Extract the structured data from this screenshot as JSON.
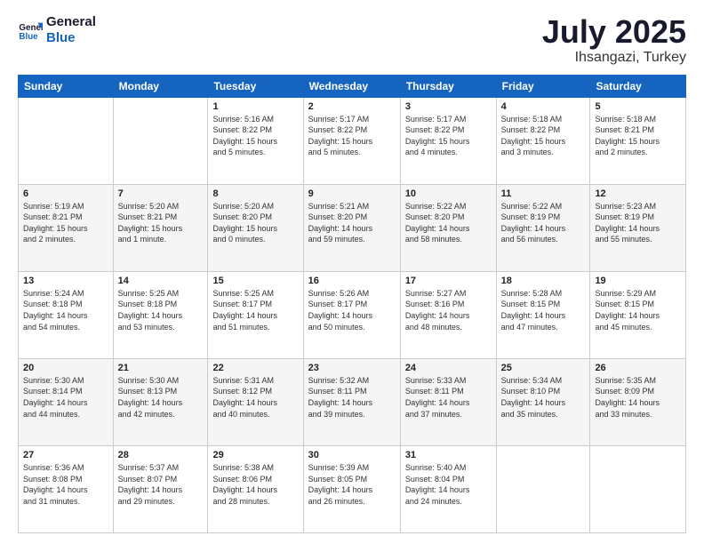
{
  "logo": {
    "text_general": "General",
    "text_blue": "Blue"
  },
  "header": {
    "month": "July 2025",
    "location": "Ihsangazi, Turkey"
  },
  "weekdays": [
    "Sunday",
    "Monday",
    "Tuesday",
    "Wednesday",
    "Thursday",
    "Friday",
    "Saturday"
  ],
  "weeks": [
    [
      {
        "day": "",
        "info": ""
      },
      {
        "day": "",
        "info": ""
      },
      {
        "day": "1",
        "info": "Sunrise: 5:16 AM\nSunset: 8:22 PM\nDaylight: 15 hours\nand 5 minutes."
      },
      {
        "day": "2",
        "info": "Sunrise: 5:17 AM\nSunset: 8:22 PM\nDaylight: 15 hours\nand 5 minutes."
      },
      {
        "day": "3",
        "info": "Sunrise: 5:17 AM\nSunset: 8:22 PM\nDaylight: 15 hours\nand 4 minutes."
      },
      {
        "day": "4",
        "info": "Sunrise: 5:18 AM\nSunset: 8:22 PM\nDaylight: 15 hours\nand 3 minutes."
      },
      {
        "day": "5",
        "info": "Sunrise: 5:18 AM\nSunset: 8:21 PM\nDaylight: 15 hours\nand 2 minutes."
      }
    ],
    [
      {
        "day": "6",
        "info": "Sunrise: 5:19 AM\nSunset: 8:21 PM\nDaylight: 15 hours\nand 2 minutes."
      },
      {
        "day": "7",
        "info": "Sunrise: 5:20 AM\nSunset: 8:21 PM\nDaylight: 15 hours\nand 1 minute."
      },
      {
        "day": "8",
        "info": "Sunrise: 5:20 AM\nSunset: 8:20 PM\nDaylight: 15 hours\nand 0 minutes."
      },
      {
        "day": "9",
        "info": "Sunrise: 5:21 AM\nSunset: 8:20 PM\nDaylight: 14 hours\nand 59 minutes."
      },
      {
        "day": "10",
        "info": "Sunrise: 5:22 AM\nSunset: 8:20 PM\nDaylight: 14 hours\nand 58 minutes."
      },
      {
        "day": "11",
        "info": "Sunrise: 5:22 AM\nSunset: 8:19 PM\nDaylight: 14 hours\nand 56 minutes."
      },
      {
        "day": "12",
        "info": "Sunrise: 5:23 AM\nSunset: 8:19 PM\nDaylight: 14 hours\nand 55 minutes."
      }
    ],
    [
      {
        "day": "13",
        "info": "Sunrise: 5:24 AM\nSunset: 8:18 PM\nDaylight: 14 hours\nand 54 minutes."
      },
      {
        "day": "14",
        "info": "Sunrise: 5:25 AM\nSunset: 8:18 PM\nDaylight: 14 hours\nand 53 minutes."
      },
      {
        "day": "15",
        "info": "Sunrise: 5:25 AM\nSunset: 8:17 PM\nDaylight: 14 hours\nand 51 minutes."
      },
      {
        "day": "16",
        "info": "Sunrise: 5:26 AM\nSunset: 8:17 PM\nDaylight: 14 hours\nand 50 minutes."
      },
      {
        "day": "17",
        "info": "Sunrise: 5:27 AM\nSunset: 8:16 PM\nDaylight: 14 hours\nand 48 minutes."
      },
      {
        "day": "18",
        "info": "Sunrise: 5:28 AM\nSunset: 8:15 PM\nDaylight: 14 hours\nand 47 minutes."
      },
      {
        "day": "19",
        "info": "Sunrise: 5:29 AM\nSunset: 8:15 PM\nDaylight: 14 hours\nand 45 minutes."
      }
    ],
    [
      {
        "day": "20",
        "info": "Sunrise: 5:30 AM\nSunset: 8:14 PM\nDaylight: 14 hours\nand 44 minutes."
      },
      {
        "day": "21",
        "info": "Sunrise: 5:30 AM\nSunset: 8:13 PM\nDaylight: 14 hours\nand 42 minutes."
      },
      {
        "day": "22",
        "info": "Sunrise: 5:31 AM\nSunset: 8:12 PM\nDaylight: 14 hours\nand 40 minutes."
      },
      {
        "day": "23",
        "info": "Sunrise: 5:32 AM\nSunset: 8:11 PM\nDaylight: 14 hours\nand 39 minutes."
      },
      {
        "day": "24",
        "info": "Sunrise: 5:33 AM\nSunset: 8:11 PM\nDaylight: 14 hours\nand 37 minutes."
      },
      {
        "day": "25",
        "info": "Sunrise: 5:34 AM\nSunset: 8:10 PM\nDaylight: 14 hours\nand 35 minutes."
      },
      {
        "day": "26",
        "info": "Sunrise: 5:35 AM\nSunset: 8:09 PM\nDaylight: 14 hours\nand 33 minutes."
      }
    ],
    [
      {
        "day": "27",
        "info": "Sunrise: 5:36 AM\nSunset: 8:08 PM\nDaylight: 14 hours\nand 31 minutes."
      },
      {
        "day": "28",
        "info": "Sunrise: 5:37 AM\nSunset: 8:07 PM\nDaylight: 14 hours\nand 29 minutes."
      },
      {
        "day": "29",
        "info": "Sunrise: 5:38 AM\nSunset: 8:06 PM\nDaylight: 14 hours\nand 28 minutes."
      },
      {
        "day": "30",
        "info": "Sunrise: 5:39 AM\nSunset: 8:05 PM\nDaylight: 14 hours\nand 26 minutes."
      },
      {
        "day": "31",
        "info": "Sunrise: 5:40 AM\nSunset: 8:04 PM\nDaylight: 14 hours\nand 24 minutes."
      },
      {
        "day": "",
        "info": ""
      },
      {
        "day": "",
        "info": ""
      }
    ]
  ]
}
